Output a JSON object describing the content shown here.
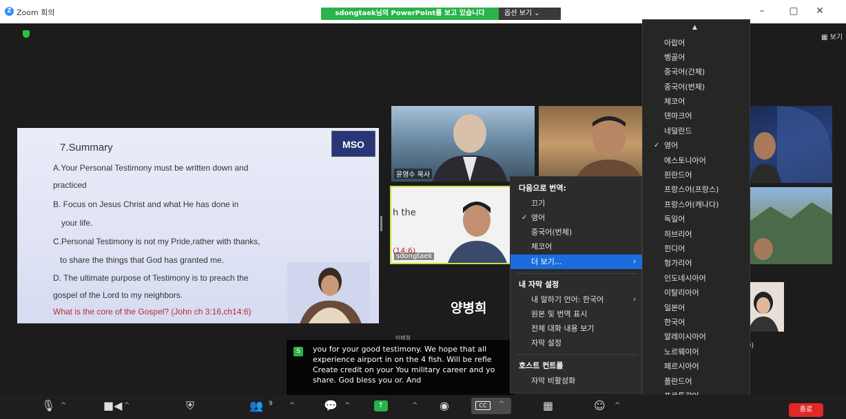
{
  "window": {
    "title": "Zoom 회의",
    "share_banner": "sdongtaek님의 PowerPoint를 보고 있습니다",
    "view_options": "옵션 보기",
    "view_toggle": "보기"
  },
  "slide": {
    "title": "7.Summary",
    "logo": "MSO",
    "lines": [
      "A.Your Personal Testimony must be written down and",
      "practiced",
      "B. Focus on Jesus Christ and what He has done in",
      "your life.",
      "C.Personal Testimony is not my Pride,rather with thanks,",
      "to share the things that God has granted me.",
      "D. The ultimate purpose of Testimony is to preach the",
      "gospel of the Lord to my neighbors."
    ],
    "question": "What is the core of the Gospel? (John ch 3:16,ch14:6)"
  },
  "tiles": {
    "t1_name": "윤영수 목사",
    "t3_caption1": "h the",
    "t3_caption2": "(14:6)",
    "t3_name": "sdongtaek",
    "speaker_big": "양병희",
    "speaker_sub": "이병희",
    "so_label": "SO)"
  },
  "captions": {
    "text": "you for your good testimony. We hope that all experience airport in on the 4 fish. Will be refle Create credit on your You military career and yo share. God bless you or. And",
    "lines": [
      "you for your good testimony. We hope that all",
      "experience airport in on the 4 fish. Will be refle",
      "Create credit on your You military career and yo",
      "share. God bless you or. And"
    ]
  },
  "translate_menu": {
    "header": "다음으로 번역:",
    "items": [
      "끄기",
      "영어",
      "중국어(번체)",
      "체코어",
      "더 보기..."
    ],
    "checked_index": 1,
    "subtitle_header": "내 자막 설정",
    "my_language_label": "내 말하기 언어:",
    "my_language_value": "한국어",
    "show_original": "원본 및 번역 표시",
    "view_transcript": "전체 대화 내용 보기",
    "caption_settings": "자막 설정",
    "host_header": "호스트 컨트롤",
    "disable_captions": "자막 비활성화"
  },
  "languages_menu": {
    "items": [
      "아랍어",
      "벵골어",
      "중국어(간체)",
      "중국어(번체)",
      "체코어",
      "덴마크어",
      "네덜란드",
      "영어",
      "에스토니아어",
      "핀란드어",
      "프랑스어(프랑스)",
      "프랑스어(캐나다)",
      "독일어",
      "히브리어",
      "힌디어",
      "헝가리어",
      "인도네시아어",
      "이탈리아어",
      "일본어",
      "한국어",
      "말레이시아어",
      "노르웨이어",
      "페르시아어",
      "폴란드어",
      "포르투갈어"
    ],
    "checked_index": 7
  },
  "toolbar": {
    "participants_count": "9",
    "cc_label": "CC",
    "end_label": "종료"
  },
  "colors": {
    "share_green": "#29b34a",
    "menu_highlight": "#1b6ddf",
    "end_red": "#e02828"
  }
}
